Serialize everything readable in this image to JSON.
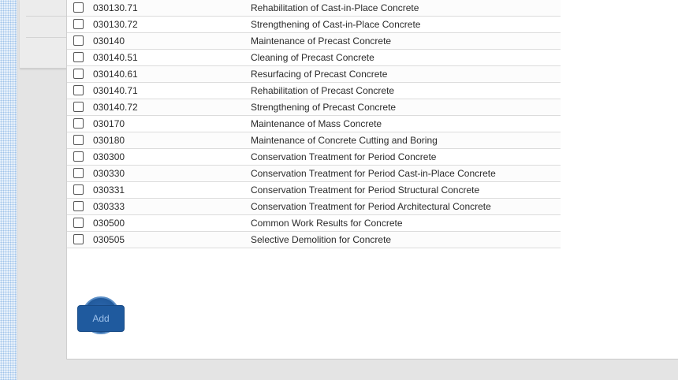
{
  "table": {
    "rows": [
      {
        "code": "030130.71",
        "title": "Rehabilitation of Cast-in-Place Concrete"
      },
      {
        "code": "030130.72",
        "title": "Strengthening of Cast-in-Place Concrete"
      },
      {
        "code": "030140",
        "title": "Maintenance of Precast Concrete"
      },
      {
        "code": "030140.51",
        "title": "Cleaning of Precast Concrete"
      },
      {
        "code": "030140.61",
        "title": "Resurfacing of Precast Concrete"
      },
      {
        "code": "030140.71",
        "title": "Rehabilitation of Precast Concrete"
      },
      {
        "code": "030140.72",
        "title": "Strengthening of Precast Concrete"
      },
      {
        "code": "030170",
        "title": "Maintenance of Mass Concrete"
      },
      {
        "code": "030180",
        "title": "Maintenance of Concrete Cutting and Boring"
      },
      {
        "code": "030300",
        "title": "Conservation Treatment for Period Concrete"
      },
      {
        "code": "030330",
        "title": "Conservation Treatment for Period Cast-in-Place Concrete"
      },
      {
        "code": "030331",
        "title": "Conservation Treatment for Period Structural Concrete"
      },
      {
        "code": "030333",
        "title": "Conservation Treatment for Period Architectural Concrete"
      },
      {
        "code": "030500",
        "title": "Common Work Results for Concrete"
      },
      {
        "code": "030505",
        "title": "Selective Demolition for Concrete"
      }
    ]
  },
  "actions": {
    "add_label": "Add"
  },
  "colors": {
    "add_button": "#1f5a9e",
    "add_label": "#9cc0ea"
  }
}
